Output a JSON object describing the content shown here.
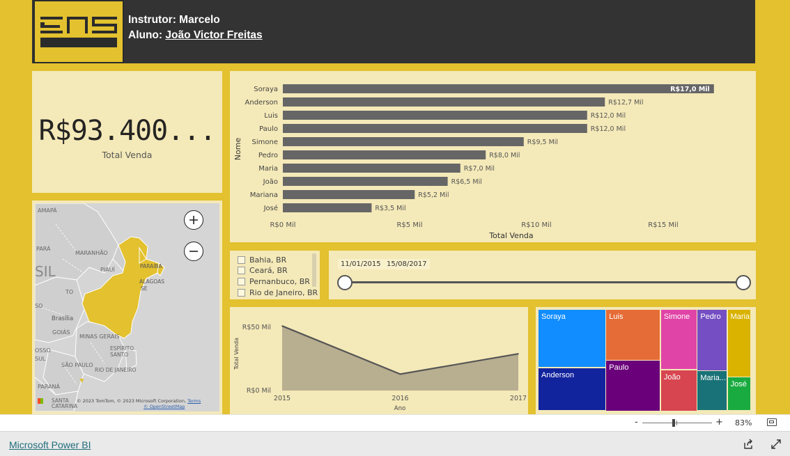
{
  "header": {
    "instructor": "Instrutor: Marcelo",
    "student_prefix": "Aluno: ",
    "student_name": "João Victor Freitas"
  },
  "kpi": {
    "value": "R$93.400...",
    "label": "Total Venda"
  },
  "bar_chart": {
    "y_title": "Nome",
    "x_title": "Total Venda",
    "tick_labels": [
      "R$0 Mil",
      "R$5 Mil",
      "R$10 Mil",
      "R$15 Mil"
    ]
  },
  "map": {
    "labels": [
      "AMAPÁ",
      "PARÁ",
      "MARANHÃO",
      "PIAUÍ",
      "SIL",
      "TO",
      "SO",
      "Brasília",
      "GOIÁS",
      "MINAS GERAIS",
      "OSSO",
      "SUL",
      "SÃO PAULO",
      "RIO DE JANEIRO",
      "ESPÍRITO SANTO",
      "PARANÁ",
      "SANTA CATARINA",
      "PARAÍBA",
      "ALAGOAS",
      "SE"
    ],
    "attribution": "© 2023 TomTom, © 2023 Microsoft Corporation,",
    "terms": "Terms",
    "osm": "© OpenStreetMap",
    "highlight_color": "#e3c12f"
  },
  "slicer": {
    "items": [
      "Bahia, BR",
      "Ceará, BR",
      "Pernanbuco, BR",
      "Rio de Janeiro, BR"
    ]
  },
  "date_slicer": {
    "start": "11/01/2015",
    "end": "15/08/2017"
  },
  "treemap": {
    "tiles": [
      {
        "name": "Soraya",
        "color": "#118dff"
      },
      {
        "name": "Anderson",
        "color": "#12239e"
      },
      {
        "name": "Luis",
        "color": "#e66c37"
      },
      {
        "name": "Paulo",
        "color": "#6b007b"
      },
      {
        "name": "Simone",
        "color": "#e044a7"
      },
      {
        "name": "Pedro",
        "color": "#744ec2"
      },
      {
        "name": "Maria",
        "color": "#d9b300"
      },
      {
        "name": "João",
        "color": "#d64550"
      },
      {
        "name": "Maria...",
        "color": "#197278"
      },
      {
        "name": "José",
        "color": "#1aab40"
      }
    ]
  },
  "zoom": {
    "minus": "-",
    "plus": "+",
    "percent": "83%",
    "level": 0.83
  },
  "footer": {
    "link": "Microsoft Power BI"
  },
  "colors": {
    "background": "#e3c12f",
    "card": "#f4e9b8",
    "header": "#333333",
    "bar": "#666666",
    "area": "#b8ae90"
  },
  "chart_data": [
    {
      "type": "bar",
      "orientation": "horizontal",
      "categories": [
        "Soraya",
        "Anderson",
        "Luis",
        "Paulo",
        "Simone",
        "Pedro",
        "Maria",
        "João",
        "Mariana",
        "José"
      ],
      "values": [
        17.0,
        12.7,
        12.0,
        12.0,
        9.5,
        8.0,
        7.0,
        6.5,
        5.2,
        3.5
      ],
      "data_labels": [
        "R$17,0 Mil",
        "R$12,7 Mil",
        "R$12,0 Mil",
        "R$12,0 Mil",
        "R$9,5 Mil",
        "R$8,0 Mil",
        "R$7,0 Mil",
        "R$6,5 Mil",
        "R$5,2 Mil",
        "R$3,5 Mil"
      ],
      "xlabel": "Total Venda",
      "ylabel": "Nome",
      "xlim": [
        0,
        17.5
      ],
      "ticks": [
        0,
        5,
        10,
        15
      ]
    },
    {
      "type": "area",
      "x": [
        "2015",
        "2016",
        "2017"
      ],
      "values": [
        51,
        13,
        29
      ],
      "xlabel": "Ano",
      "ylabel": "Total Venda",
      "ylim": [
        0,
        50
      ],
      "ytick_labels": [
        "R$50 Mil",
        "R$0 Mil"
      ]
    },
    {
      "type": "treemap",
      "categories": [
        "Soraya",
        "Anderson",
        "Luis",
        "Paulo",
        "Simone",
        "Pedro",
        "Maria",
        "João",
        "Mariana",
        "José"
      ],
      "values": [
        17.0,
        12.7,
        12.0,
        12.0,
        9.5,
        8.0,
        7.0,
        6.5,
        5.2,
        3.5
      ]
    }
  ]
}
